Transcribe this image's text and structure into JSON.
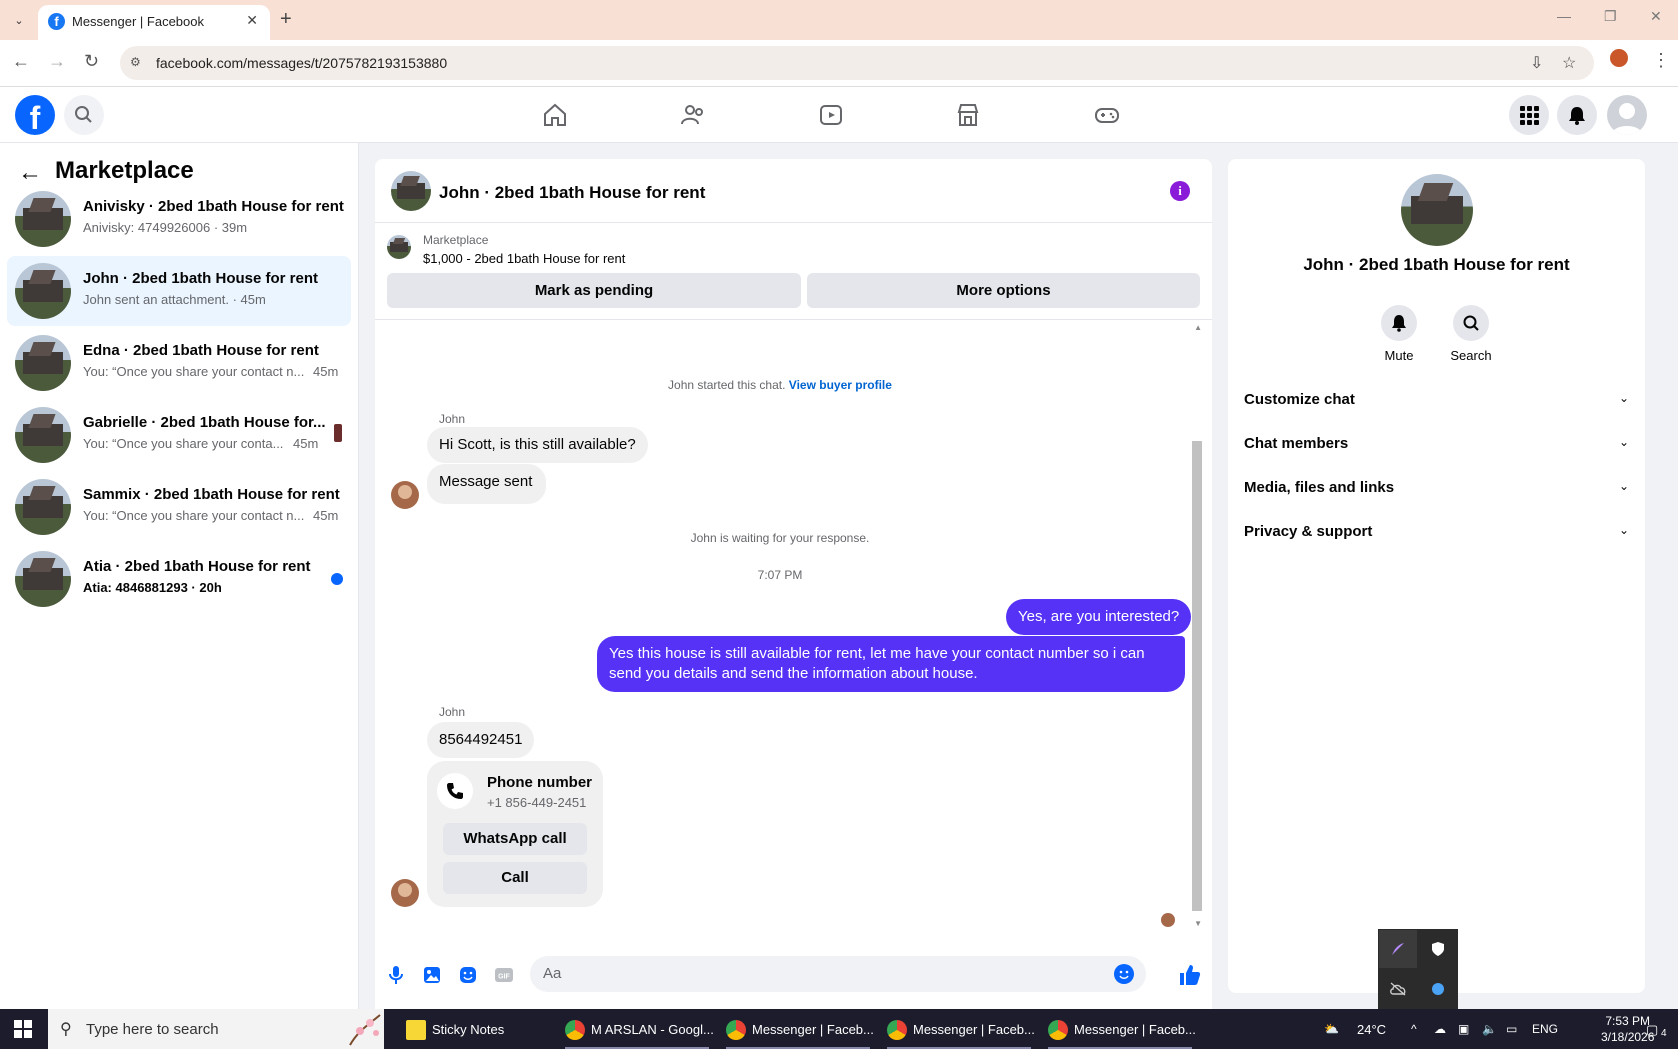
{
  "browser": {
    "tab_title": "Messenger | Facebook",
    "url": "facebook.com/messages/t/2075782193153880"
  },
  "sidebar": {
    "title": "Marketplace",
    "conversations": [
      {
        "name": "Anivisky · 2bed 1bath House for rent",
        "preview": "Anivisky: 4749926006 · 39m",
        "time": ""
      },
      {
        "name": "John · 2bed 1bath House for rent",
        "preview": "John sent an attachment. · 45m",
        "time": ""
      },
      {
        "name": "Edna · 2bed 1bath House for rent",
        "preview": "You: “Once you share your contact n...",
        "time": "45m"
      },
      {
        "name": "Gabrielle · 2bed 1bath House for...",
        "preview": "You: “Once you share your conta...",
        "time": "45m"
      },
      {
        "name": "Sammix · 2bed 1bath House for rent",
        "preview": "You: “Once you share your contact n...",
        "time": "45m"
      },
      {
        "name": "Atia · 2bed 1bath House for rent",
        "preview": "Atia: 4846881293 · 20h",
        "time": ""
      }
    ]
  },
  "chat": {
    "title": "John · 2bed 1bath House for rent",
    "listing_label": "Marketplace",
    "listing_price": "$1,000 - 2bed 1bath House for rent",
    "mark_pending": "Mark as pending",
    "more_options": "More options",
    "started_text": "John started this chat.",
    "view_profile": "View buyer profile",
    "sender_name": "John",
    "msg1": "Hi Scott, is this still available?",
    "msg2": "Message sent",
    "waiting_text": "John is waiting for your response.",
    "timestamp": "7:07 PM",
    "my_msg1": "Yes, are you interested?",
    "my_msg2_line1": "Yes this house is still available for rent, let me have your contact number so i can",
    "my_msg2_line2": "send you details and send the information about house.",
    "sender_name2": "John",
    "msg3": "8564492451",
    "phone_title": "Phone number",
    "phone_number": "+1 856-449-2451",
    "whatsapp_call": "WhatsApp call",
    "call": "Call",
    "composer_placeholder": "Aa"
  },
  "info_panel": {
    "name": "John · 2bed 1bath House for rent",
    "mute": "Mute",
    "search": "Search",
    "sections": [
      "Customize chat",
      "Chat members",
      "Media, files and links",
      "Privacy & support"
    ]
  },
  "taskbar": {
    "search_placeholder": "Type here to search",
    "items": [
      "Sticky Notes",
      "M ARSLAN - Googl...",
      "Messenger | Faceb...",
      "Messenger | Faceb...",
      "Messenger | Faceb..."
    ],
    "temperature": "24°C",
    "language": "ENG",
    "time": "7:53 PM",
    "date": "3/18/2026",
    "notification_count": "4"
  },
  "colors": {
    "accent": "#0866ff",
    "my_bubble": "#5532f5",
    "info_icon": "#8a1bd8"
  }
}
